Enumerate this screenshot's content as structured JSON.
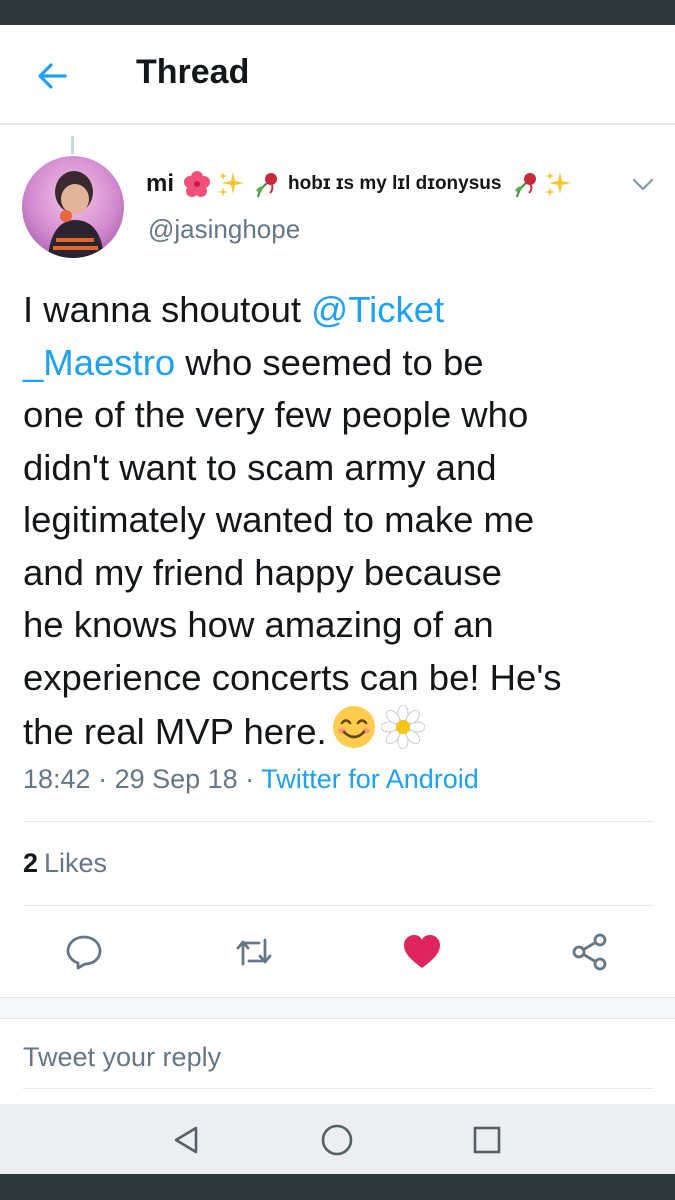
{
  "header": {
    "title": "Thread"
  },
  "tweet": {
    "display_name": "mi",
    "name_suffix": "hobɪ ɪs my lɪl dɪonysus",
    "handle": "@jasinghope",
    "text_lines": [
      {
        "before": "I wanna shoutout ",
        "mention": "@Ticket",
        "after": ""
      },
      {
        "before": "",
        "mention": "_Maestro",
        "after": " who seemed to be"
      },
      {
        "before": "one of the very few people who",
        "mention": "",
        "after": ""
      },
      {
        "before": "didn't want to scam army and",
        "mention": "",
        "after": ""
      },
      {
        "before": "legitimately wanted to make me",
        "mention": "",
        "after": ""
      },
      {
        "before": "and my friend happy because",
        "mention": "",
        "after": ""
      },
      {
        "before": "he knows how amazing of an",
        "mention": "",
        "after": ""
      },
      {
        "before": "experience concerts can be! He's",
        "mention": "",
        "after": ""
      },
      {
        "before": "the real MVP here.",
        "mention": "",
        "after": ""
      }
    ],
    "time": "18:42",
    "sep": " · ",
    "date": "29 Sep 18",
    "source": "Twitter for Android",
    "likes_count": "2",
    "likes_label": "Likes",
    "name_emojis": [
      "hibiscus-icon",
      "sparkles-icon",
      "wilted-rose-icon",
      "wilted-rose-icon",
      "sparkles-icon"
    ],
    "end_emojis": [
      "smiling-face-icon",
      "daisy-icon"
    ]
  },
  "reply": {
    "placeholder": "Tweet your reply"
  },
  "colors": {
    "accent": "#1da1f2",
    "like": "#e0245e",
    "muted": "#657786",
    "text": "#14171a",
    "system_bar": "#2d3b40"
  }
}
